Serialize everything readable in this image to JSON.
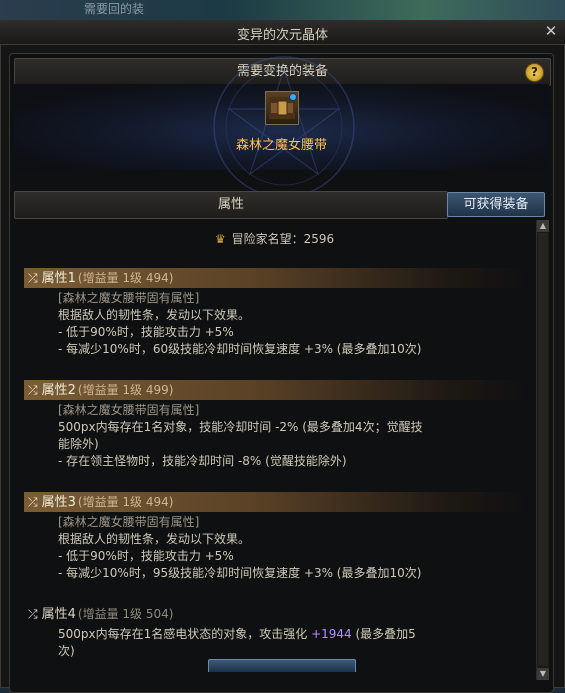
{
  "background": {
    "top_text": "需要回的装"
  },
  "window": {
    "title": "变异的次元晶体"
  },
  "required": {
    "header": "需要变换的装备",
    "help_label": "?",
    "equip_name": "森林之魔女腰带"
  },
  "attributes": {
    "header": "属性",
    "obtainable_button": "可获得装备",
    "fame_label": "冒险家名望：2596",
    "items": [
      {
        "name": "属性1",
        "sub": "(增益量 1级 494)",
        "source": "[森林之魔女腰带固有属性]",
        "lines": [
          "根据敌人的韧性条，发动以下效果。",
          "- 低于90%时，技能攻击力 +5%",
          "- 每减少10%时，60级技能冷却时间恢复速度 +3% (最多叠加10次)"
        ]
      },
      {
        "name": "属性2",
        "sub": "(增益量 1级 499)",
        "source": "[森林之魔女腰带固有属性]",
        "lines": [
          "500px内每存在1名对象，技能冷却时间 -2% (最多叠加4次；觉醒技",
          "能除外)",
          "- 存在领主怪物时，技能冷却时间 -8% (觉醒技能除外)"
        ]
      },
      {
        "name": "属性3",
        "sub": "(增益量 1级 494)",
        "source": "[森林之魔女腰带固有属性]",
        "lines": [
          "根据敌人的韧性条，发动以下效果。",
          "- 低于90%时，技能攻击力 +5%",
          "- 每减少10%时，95级技能冷却时间恢复速度 +3% (最多叠加10次)"
        ]
      },
      {
        "name": "属性4",
        "sub": "(增益量 1级 504)",
        "line1_prefix": "500px内每存在1名感电状态的对象，攻击强化 ",
        "line1_value": "+1944",
        "line1_suffix": " (最多叠加5",
        "line2": "次)"
      }
    ]
  },
  "colors": {
    "equip_name": "#ffc34a",
    "highlight": "#b98cff",
    "attr_bar": "#7a5d35"
  },
  "icons": [
    "close-icon",
    "help-icon",
    "fame-icon",
    "shuffle-icon",
    "belt-icon"
  ]
}
